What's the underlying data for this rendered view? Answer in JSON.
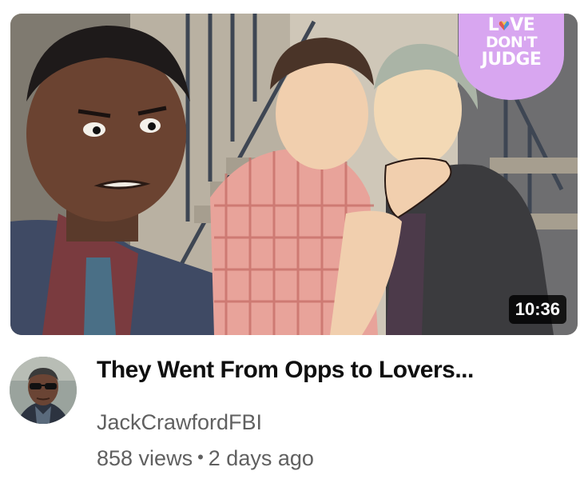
{
  "video": {
    "title": "They Went From Opps to Lovers...",
    "duration": "10:36",
    "badge": {
      "line1_heart_letter": "L",
      "line1_rest": "VE",
      "line2": "DON'T",
      "line3": "JUDGE"
    }
  },
  "channel": {
    "name": "JackCrawfordFBI",
    "avatar_icon": "channel-avatar"
  },
  "stats": {
    "views": "858 views",
    "separator": "•",
    "age": "2 days ago"
  },
  "colors": {
    "title": "#0f0f0f",
    "secondary_text": "#606060",
    "badge_bg": "#d8a6f0",
    "duration_bg": "#000000"
  }
}
